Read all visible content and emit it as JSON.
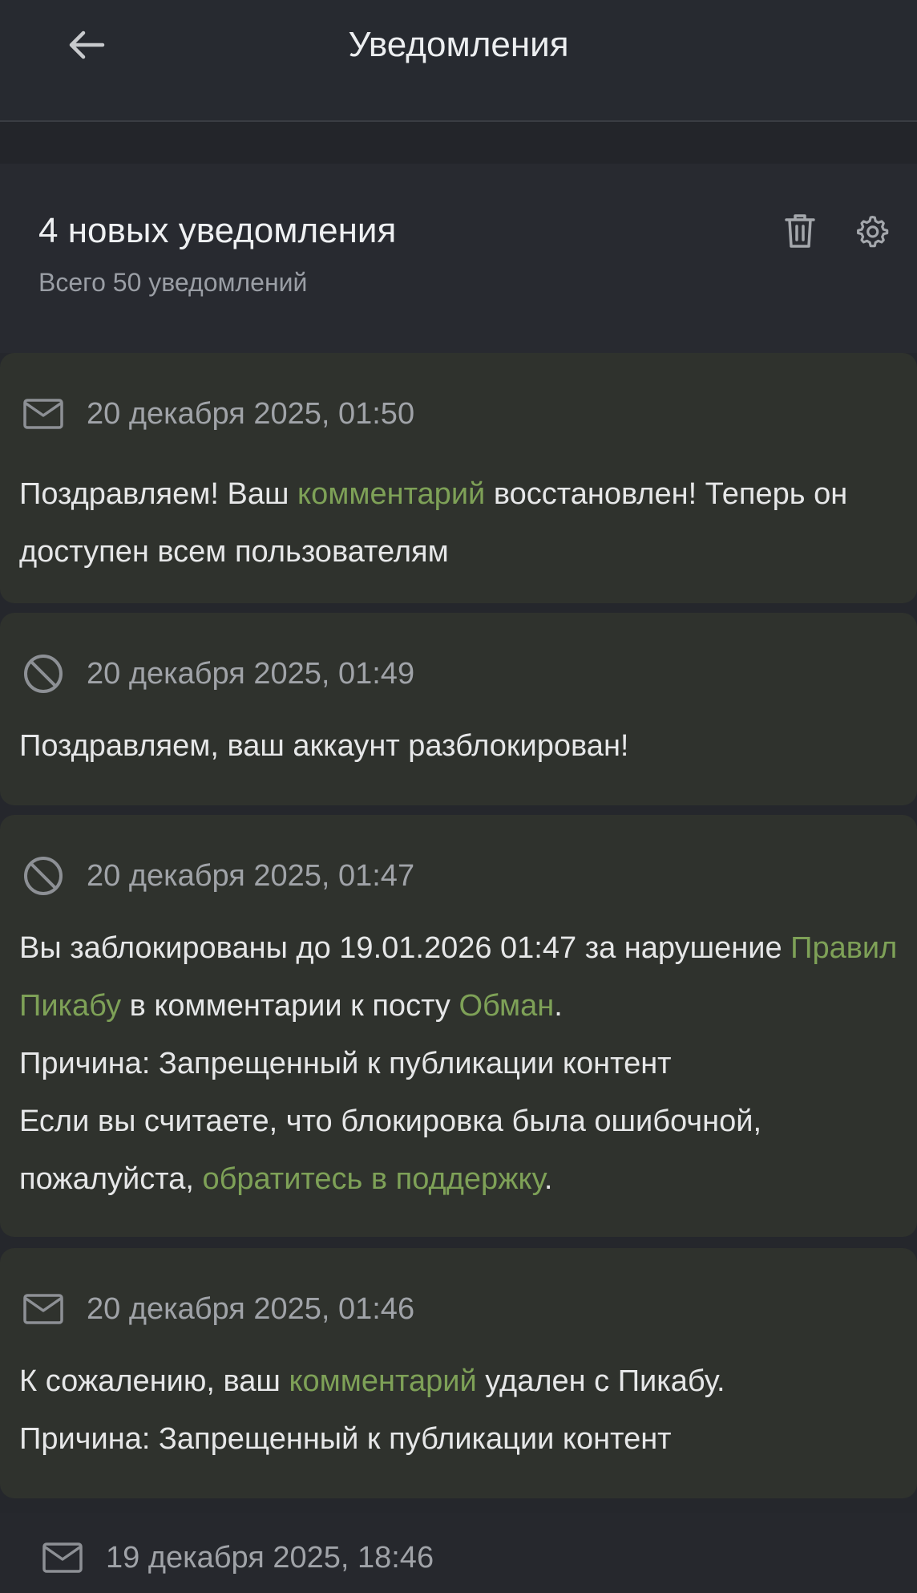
{
  "header": {
    "title": "Уведомления"
  },
  "summary": {
    "title": "4 новых уведомления",
    "subtitle": "Всего 50 уведомлений"
  },
  "colors": {
    "background": "#25272c",
    "card": "#2f322d",
    "link": "#7ea157",
    "date": "#a0a3a8"
  },
  "notifications": [
    {
      "icon": "mail-icon",
      "date": "20 декабря 2025, 01:50",
      "text": {
        "p1": "Поздравляем! Ваш ",
        "link1": "комментарий",
        "p2": " восстановлен! Теперь он доступен всем пользователям"
      }
    },
    {
      "icon": "blocked-icon",
      "date": "20 декабря 2025, 01:49",
      "text": {
        "p1": "Поздравляем, ваш аккаунт разблокирован!"
      }
    },
    {
      "icon": "blocked-icon",
      "date": "20 декабря 2025, 01:47",
      "text": {
        "p1": "Вы заблокированы до 19.01.2026 01:47 за нарушение ",
        "link1": "Правил Пикабу",
        "p2": " в комментарии к посту ",
        "link2": "Обман",
        "p3": ".",
        "line2": "Причина: Запрещенный к публикации контент",
        "line3a": "Если вы считаете, что блокировка была ошибочной, пожалуйста, ",
        "link3": "обратитесь в поддержку",
        "line3b": "."
      }
    },
    {
      "icon": "mail-icon",
      "date": "20 декабря 2025, 01:46",
      "text": {
        "p1": "К сожалению, ваш ",
        "link1": "комментарий",
        "p2": " удален с Пикабу.",
        "line2": "Причина: Запрещенный к публикации контент"
      }
    },
    {
      "icon": "mail-icon",
      "date": "19 декабря 2025, 18:46"
    }
  ]
}
